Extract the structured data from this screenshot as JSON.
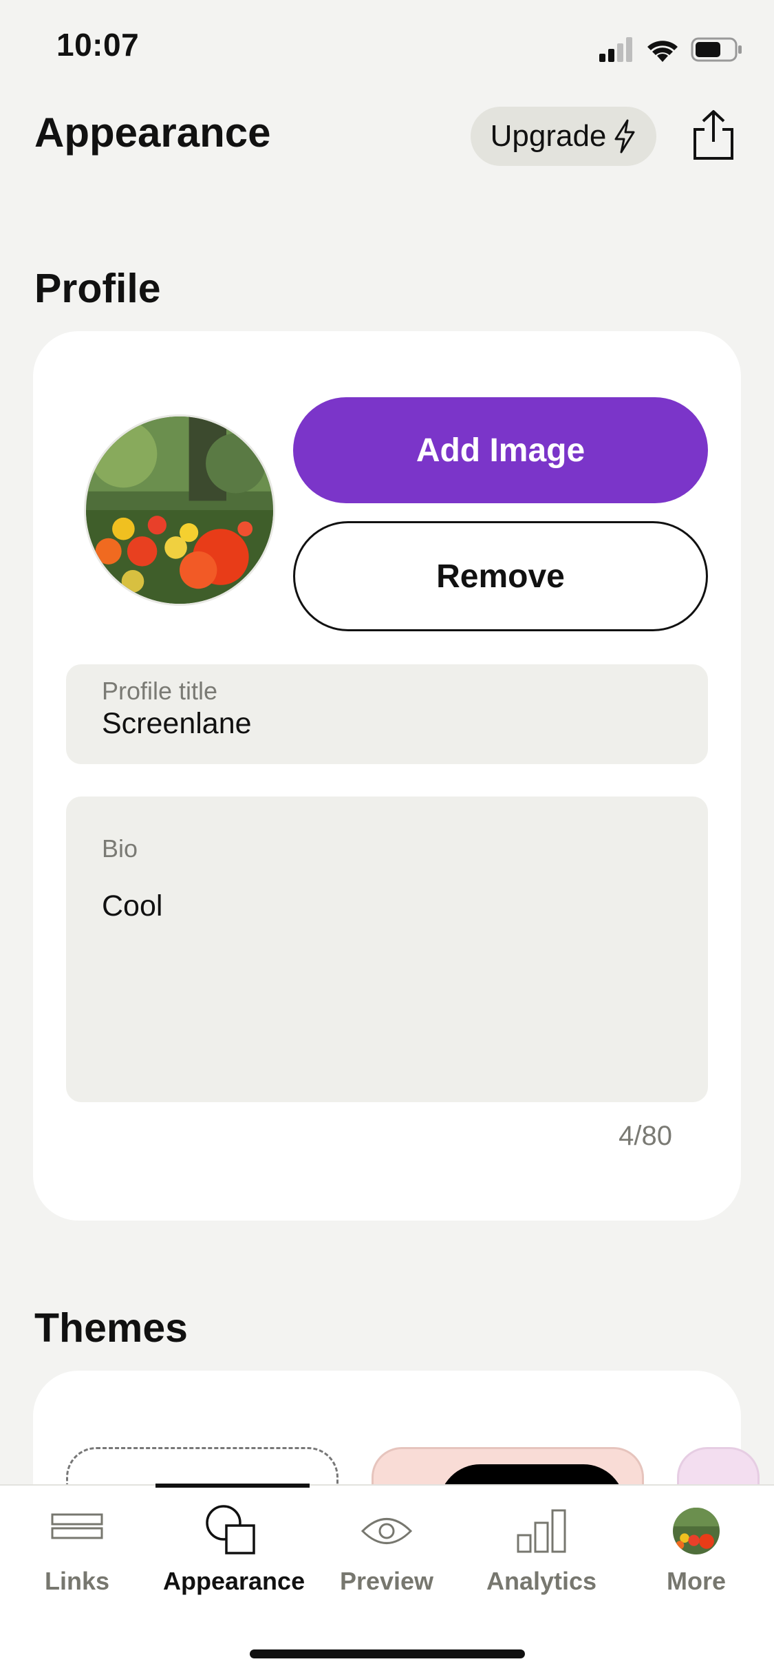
{
  "status_bar": {
    "time": "10:07"
  },
  "header": {
    "title": "Appearance",
    "upgrade_label": "Upgrade",
    "share_icon": "share-icon"
  },
  "profile": {
    "heading": "Profile",
    "add_image_label": "Add Image",
    "remove_label": "Remove",
    "title_field": {
      "label": "Profile title",
      "value": "Screenlane"
    },
    "bio_field": {
      "label": "Bio",
      "value": "Cool",
      "counter": "4/80"
    }
  },
  "themes": {
    "heading": "Themes"
  },
  "tabs": [
    {
      "label": "Links",
      "icon": "links-icon"
    },
    {
      "label": "Appearance",
      "icon": "appearance-icon",
      "active": true
    },
    {
      "label": "Preview",
      "icon": "eye-icon"
    },
    {
      "label": "Analytics",
      "icon": "bar-chart-icon"
    },
    {
      "label": "More",
      "icon": "avatar"
    }
  ],
  "colors": {
    "accent": "#7b35c9",
    "background": "#f3f3f1",
    "field": "#efefeb"
  }
}
